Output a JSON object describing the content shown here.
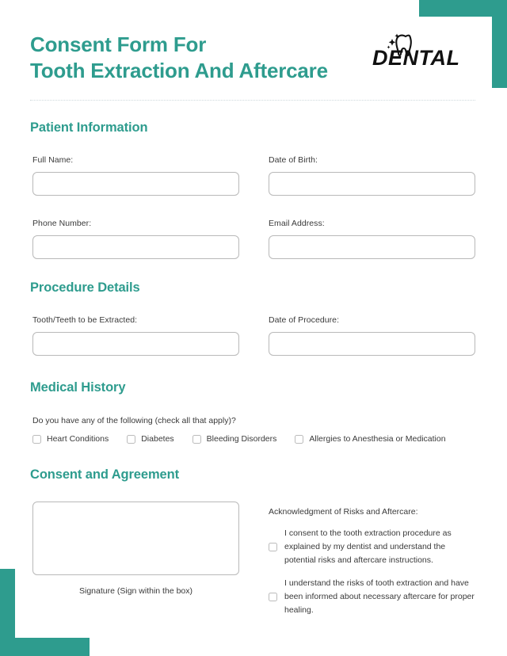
{
  "theme": {
    "accent": "#2E9C8E",
    "text": "#3a3a3a",
    "border": "#b9b9b9"
  },
  "header": {
    "title_line1": "Consent Form For",
    "title_line2": "Tooth Extraction And Aftercare",
    "logo_text": "DENTAL"
  },
  "sections": {
    "patient_information": {
      "heading": "Patient Information",
      "fields": [
        {
          "label": "Full Name:",
          "value": "",
          "placeholder": ""
        },
        {
          "label": "Date of Birth:",
          "value": "",
          "placeholder": ""
        },
        {
          "label": "Phone Number:",
          "value": "",
          "placeholder": ""
        },
        {
          "label": "Email Address:",
          "value": "",
          "placeholder": ""
        }
      ]
    },
    "procedure_details": {
      "heading": "Procedure Details",
      "fields": [
        {
          "label": "Tooth/Teeth to be Extracted:",
          "value": "",
          "placeholder": ""
        },
        {
          "label": "Date of Procedure:",
          "value": "",
          "placeholder": ""
        }
      ]
    },
    "medical_history": {
      "heading": "Medical History",
      "question": "Do you have any of the following (check all that apply)?",
      "options": [
        {
          "label": "Heart Conditions",
          "checked": false
        },
        {
          "label": "Diabetes",
          "checked": false
        },
        {
          "label": "Bleeding Disorders",
          "checked": false
        },
        {
          "label": "Allergies to Anesthesia or Medication",
          "checked": false
        }
      ]
    },
    "consent_and_agreement": {
      "heading": "Consent and Agreement",
      "signature_caption": "Signature (Sign within the box)",
      "acknowledgment_title": "Acknowledgment of Risks and Aftercare:",
      "acknowledgments": [
        {
          "text": "I consent to the tooth extraction procedure as explained by my dentist and understand the potential risks and aftercare instructions.",
          "checked": false
        },
        {
          "text": "I understand the risks of tooth extraction and have been informed about necessary aftercare for proper healing.",
          "checked": false
        }
      ]
    }
  }
}
